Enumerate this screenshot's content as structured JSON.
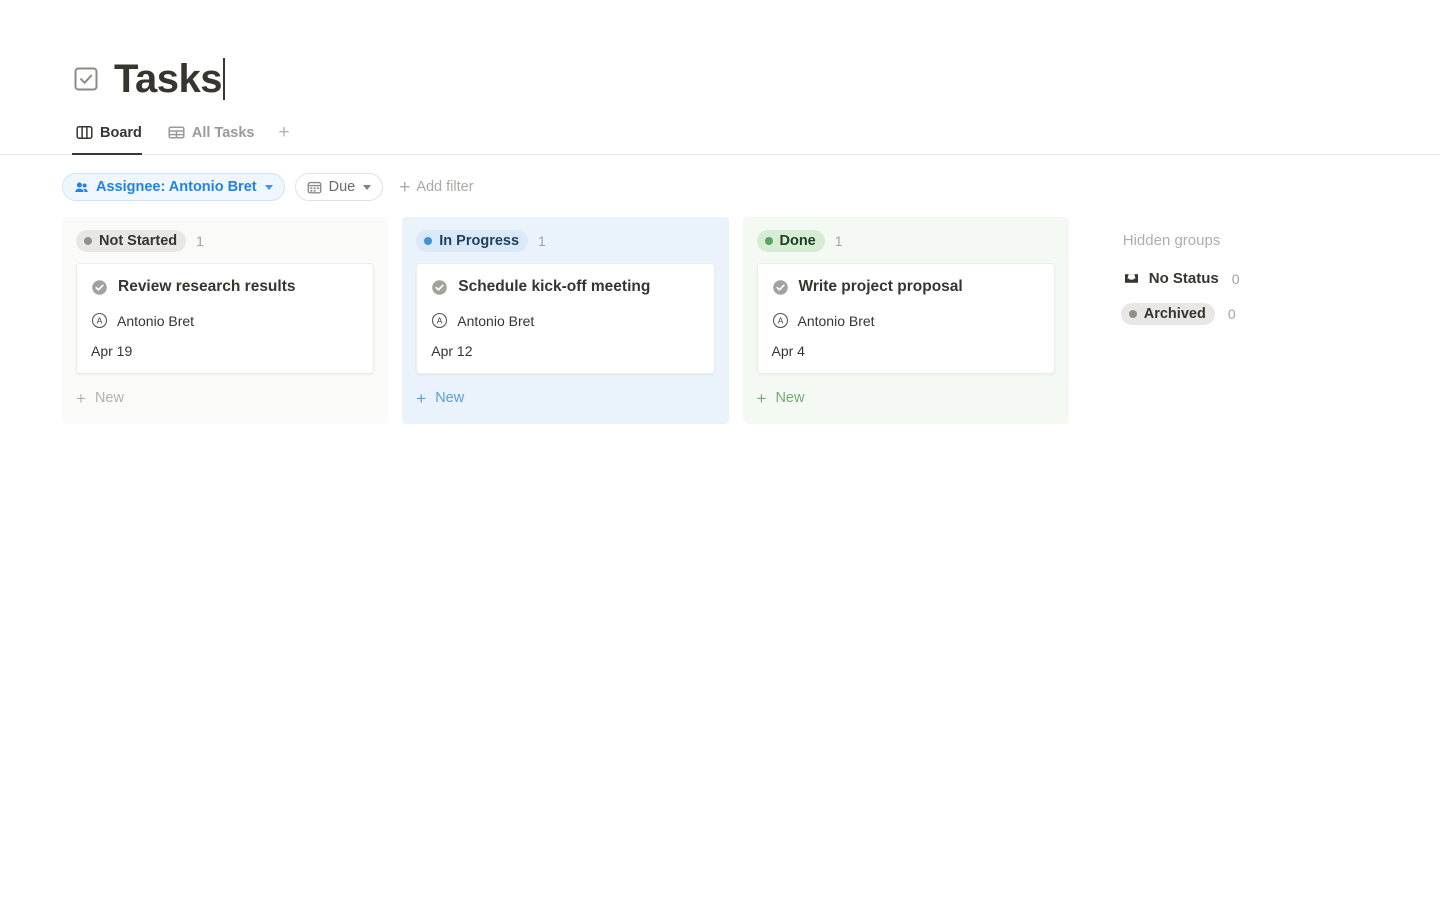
{
  "page": {
    "title": "Tasks",
    "title_icon": "checkbox-square-icon",
    "has_text_cursor": true
  },
  "tabs": {
    "items": [
      {
        "label": "Board",
        "icon": "board-columns-icon",
        "active": true
      },
      {
        "label": "All Tasks",
        "icon": "table-grid-icon",
        "active": false
      }
    ],
    "add_label": "+"
  },
  "filters": {
    "chips": [
      {
        "label": "Assignee: Antonio Bret",
        "icon": "people-icon",
        "active": true
      },
      {
        "label": "Due",
        "icon": "calendar-icon",
        "active": false
      }
    ],
    "add_filter_label": "Add filter",
    "add_filter_icon": "plus-icon"
  },
  "board": {
    "new_label": "New",
    "columns": [
      {
        "status": "Not Started",
        "count": "1",
        "color": "#918f8a",
        "badge_bg": "#e8e7e4",
        "column_bg": "#fafaf9",
        "cards": [
          {
            "title": "Review research results",
            "assignee": "Antonio Bret",
            "avatar_initial": "A",
            "date": "Apr 19"
          }
        ]
      },
      {
        "status": "In Progress",
        "count": "1",
        "color": "#3d93d6",
        "badge_bg": "#d9e9f7",
        "column_bg": "#eaf3fb",
        "cards": [
          {
            "title": "Schedule kick-off meeting",
            "assignee": "Antonio Bret",
            "avatar_initial": "A",
            "date": "Apr 12"
          }
        ]
      },
      {
        "status": "Done",
        "count": "1",
        "color": "#5aa45c",
        "badge_bg": "#d6ecd5",
        "column_bg": "#f5f9f4",
        "cards": [
          {
            "title": "Write project proposal",
            "assignee": "Antonio Bret",
            "avatar_initial": "A",
            "date": "Apr 4"
          }
        ]
      }
    ]
  },
  "hidden_groups": {
    "title": "Hidden groups",
    "items": [
      {
        "label": "No Status",
        "count": "0",
        "icon": "inbox-icon",
        "badge": false
      },
      {
        "label": "Archived",
        "count": "0",
        "icon": "dot-icon",
        "badge": true
      }
    ]
  }
}
